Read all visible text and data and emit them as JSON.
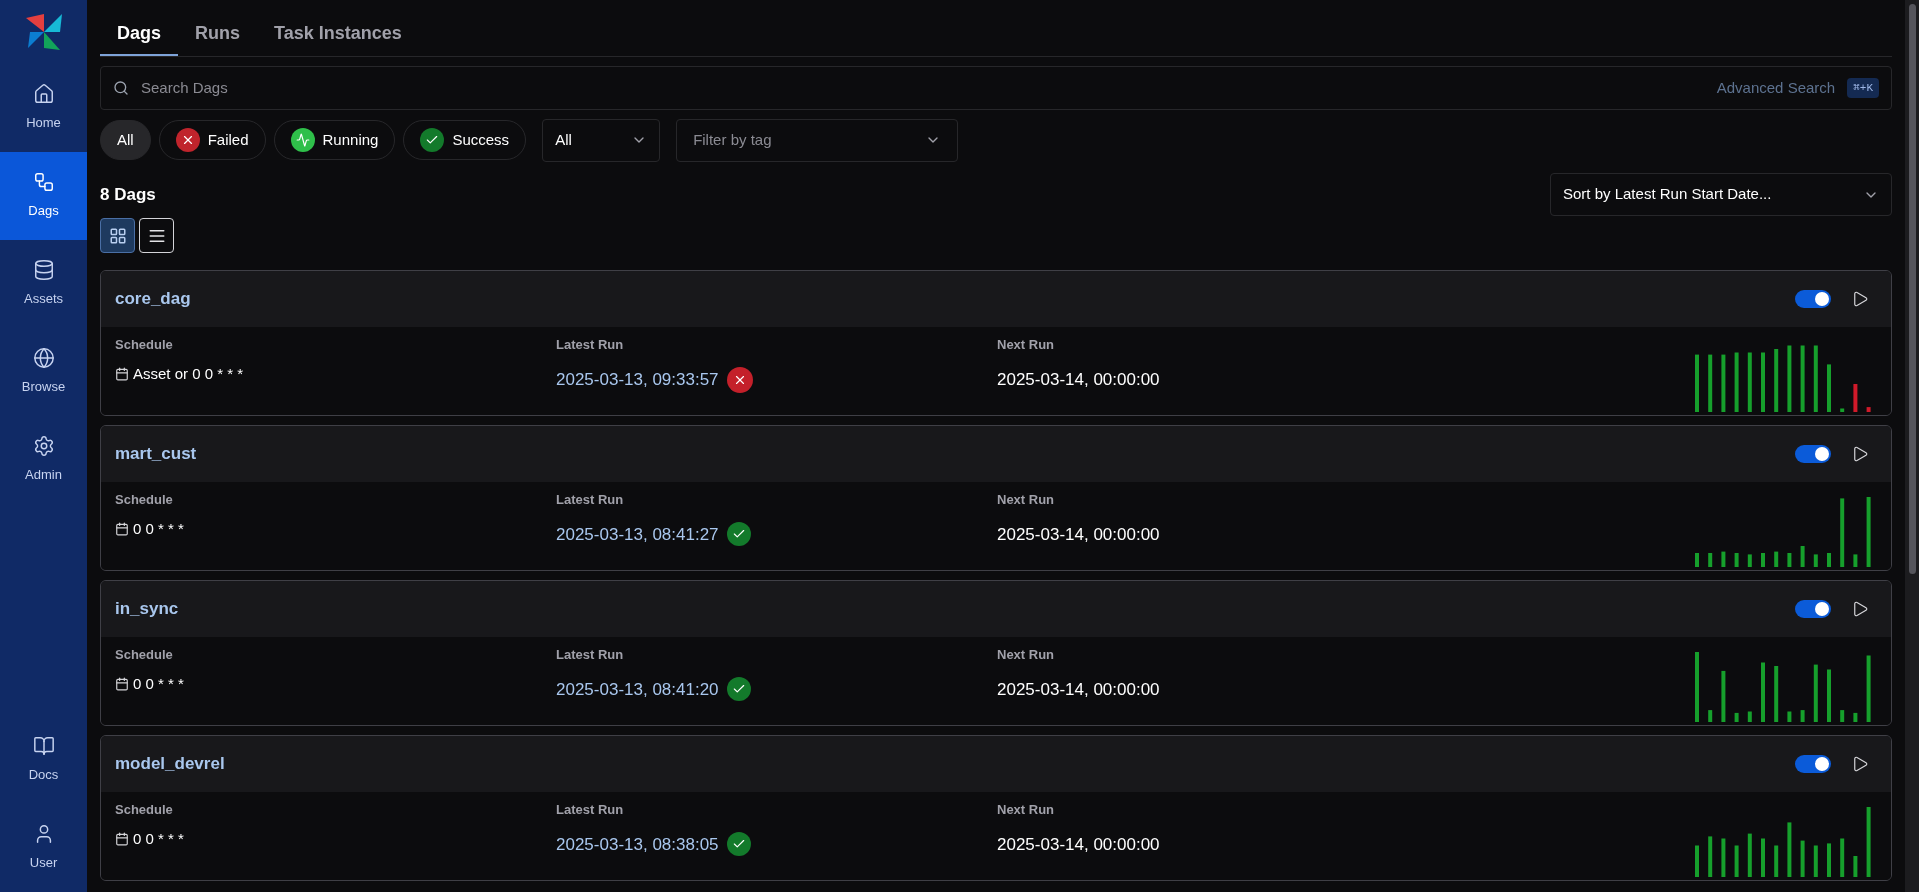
{
  "sidebar": {
    "items": [
      {
        "label": "Home",
        "selected": false
      },
      {
        "label": "Dags",
        "selected": true
      },
      {
        "label": "Assets",
        "selected": false
      },
      {
        "label": "Browse",
        "selected": false
      },
      {
        "label": "Admin",
        "selected": false
      }
    ],
    "bottom_items": [
      {
        "label": "Docs",
        "selected": false
      },
      {
        "label": "User",
        "selected": false
      }
    ]
  },
  "tabs": [
    {
      "label": "Dags",
      "selected": true
    },
    {
      "label": "Runs",
      "selected": false
    },
    {
      "label": "Task Instances",
      "selected": false
    }
  ],
  "search": {
    "placeholder": "Search Dags",
    "advanced": "Advanced Search",
    "shortcut": "⌘+K"
  },
  "state_filters": [
    {
      "label": "All",
      "kind": "all",
      "selected": true
    },
    {
      "label": "Failed",
      "kind": "failed",
      "selected": false
    },
    {
      "label": "Running",
      "kind": "running",
      "selected": false
    },
    {
      "label": "Success",
      "kind": "success",
      "selected": false
    }
  ],
  "paused_select": {
    "value": "All"
  },
  "tag_select": {
    "placeholder": "Filter by tag"
  },
  "count": "8 Dags",
  "sort_select": {
    "value": "Sort by Latest Run Start Date..."
  },
  "view_toggle": [
    {
      "kind": "grid",
      "selected": true
    },
    {
      "kind": "list",
      "selected": false
    }
  ],
  "dags": [
    {
      "name": "core_dag",
      "enabled": true,
      "schedule_label": "Schedule",
      "schedule": "Asset or 0 0 * * *",
      "latest_label": "Latest Run",
      "latest_run": {
        "text": "2025-03-13, 09:33:57",
        "kind": "failed"
      },
      "next_label": "Next Run",
      "next_run": "2025-03-14, 00:00:00"
    },
    {
      "name": "mart_cust",
      "enabled": true,
      "schedule_label": "Schedule",
      "schedule": "0 0 * * *",
      "latest_label": "Latest Run",
      "latest_run": {
        "text": "2025-03-13, 08:41:27",
        "kind": "success"
      },
      "next_label": "Next Run",
      "next_run": "2025-03-14, 00:00:00"
    },
    {
      "name": "in_sync",
      "enabled": true,
      "schedule_label": "Schedule",
      "schedule": "0 0 * * *",
      "latest_label": "Latest Run",
      "latest_run": {
        "text": "2025-03-13, 08:41:20",
        "kind": "success"
      },
      "next_label": "Next Run",
      "next_run": "2025-03-14, 00:00:00"
    },
    {
      "name": "model_devrel",
      "enabled": true,
      "schedule_label": "Schedule",
      "schedule": "0 0 * * *",
      "latest_label": "Latest Run",
      "latest_run": {
        "text": "2025-03-13, 08:38:05",
        "kind": "success"
      },
      "next_label": "Next Run",
      "next_run": "2025-03-14, 00:00:00"
    }
  ]
}
